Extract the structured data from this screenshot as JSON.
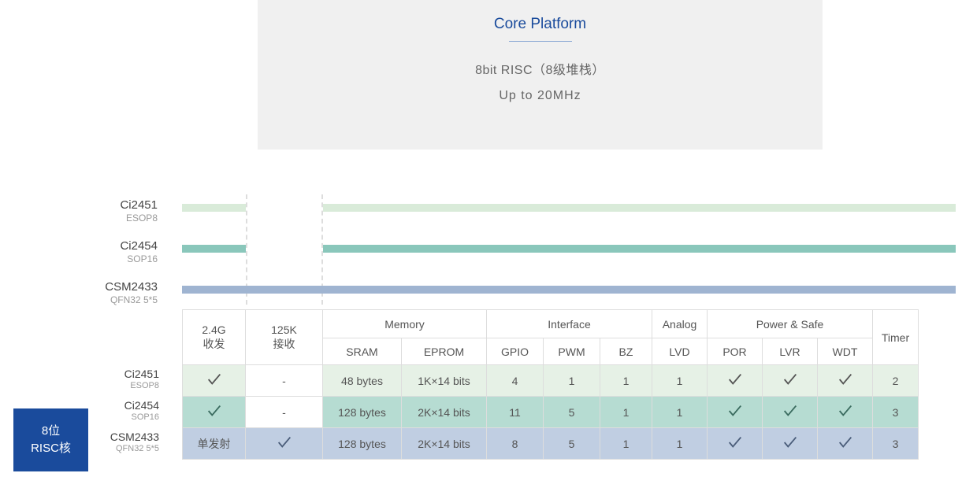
{
  "core": {
    "title": "Core Platform",
    "line1": "8bit RISC（8级堆栈）",
    "line2": "Up to 20MHz"
  },
  "blue": {
    "line1": "8位",
    "line2": "RISC核"
  },
  "products": [
    {
      "name": "Ci2451",
      "pkg": "ESOP8"
    },
    {
      "name": "Ci2454",
      "pkg": "SOP16"
    },
    {
      "name": "CSM2433",
      "pkg": "QFN32 5*5"
    }
  ],
  "headers": {
    "rf24": "2.4G\n收发",
    "rx125": "125K\n接收",
    "memory": "Memory",
    "sram": "SRAM",
    "eprom": "EPROM",
    "interface": "Interface",
    "gpio": "GPIO",
    "pwm": "PWM",
    "bz": "BZ",
    "analog": "Analog",
    "lvd": "LVD",
    "power": "Power & Safe",
    "por": "POR",
    "lvr": "LVR",
    "wdt": "WDT",
    "timer": "Timer"
  },
  "chart_data": {
    "type": "table",
    "title": "Core Platform — 8bit RISC（8级堆栈） Up to 20MHz",
    "columns": [
      "Product",
      "Package",
      "2.4G 收发",
      "125K 接收",
      "SRAM",
      "EPROM",
      "GPIO",
      "PWM",
      "BZ",
      "LVD (Analog)",
      "POR",
      "LVR",
      "WDT",
      "Timer"
    ],
    "rows": [
      [
        "Ci2451",
        "ESOP8",
        "✓",
        "-",
        "48 bytes",
        "1K×14 bits",
        4,
        1,
        1,
        1,
        "✓",
        "✓",
        "✓",
        2
      ],
      [
        "Ci2454",
        "SOP16",
        "✓",
        "-",
        "128 bytes",
        "2K×14 bits",
        11,
        5,
        1,
        1,
        "✓",
        "✓",
        "✓",
        3
      ],
      [
        "CSM2433",
        "QFN32 5*5",
        "单发射",
        "✓",
        "128 bytes",
        "2K×14 bits",
        8,
        5,
        1,
        1,
        "✓",
        "✓",
        "✓",
        3
      ]
    ]
  },
  "rows": [
    {
      "rf24": "✓",
      "rx125": "-",
      "sram": "48 bytes",
      "eprom": "1K×14 bits",
      "gpio": "4",
      "pwm": "1",
      "bz": "1",
      "lvd": "1",
      "por": "✓",
      "lvr": "✓",
      "wdt": "✓",
      "timer": "2"
    },
    {
      "rf24": "✓",
      "rx125": "-",
      "sram": "128 bytes",
      "eprom": "2K×14 bits",
      "gpio": "11",
      "pwm": "5",
      "bz": "1",
      "lvd": "1",
      "por": "✓",
      "lvr": "✓",
      "wdt": "✓",
      "timer": "3"
    },
    {
      "rf24": "单发射",
      "rx125": "✓",
      "sram": "128 bytes",
      "eprom": "2K×14 bits",
      "gpio": "8",
      "pwm": "5",
      "bz": "1",
      "lvd": "1",
      "por": "✓",
      "lvr": "✓",
      "wdt": "✓",
      "timer": "3"
    }
  ]
}
